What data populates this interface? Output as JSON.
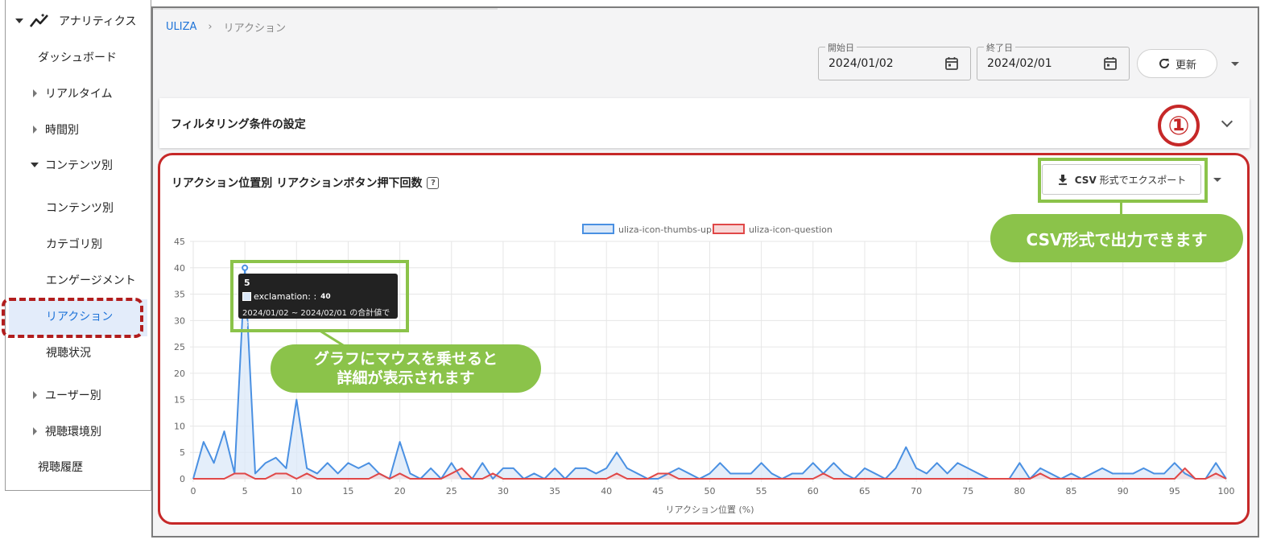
{
  "sidebar": {
    "analytics_label": "アナリティクス",
    "items": [
      {
        "label": "ダッシュボード"
      },
      {
        "label": "リアルタイム"
      },
      {
        "label": "時間別"
      },
      {
        "label": "コンテンツ別"
      },
      {
        "label": "コンテンツ別"
      },
      {
        "label": "カテゴリ別"
      },
      {
        "label": "エンゲージメント"
      },
      {
        "label": "リアクション"
      },
      {
        "label": "視聴状況"
      },
      {
        "label": "ユーザー別"
      },
      {
        "label": "視聴環境別"
      },
      {
        "label": "視聴履歴"
      }
    ]
  },
  "breadcrumb": {
    "root": "ULIZA",
    "sep": "›",
    "current": "リアクション"
  },
  "toolbar": {
    "start_legend": "開始日",
    "start_value": "2024/01/02",
    "end_legend": "終了日",
    "end_value": "2024/02/01",
    "refresh_label": "更新"
  },
  "filter": {
    "title": "フィルタリング条件の設定"
  },
  "annotations": {
    "circle_number": "①",
    "csv_callout": "CSV形式で出力できます",
    "hover_callout_line1": "グラフにマウスを乗せると",
    "hover_callout_line2": "詳細が表示されます"
  },
  "chart_panel": {
    "title": "リアクション位置別 リアクションボタン押下回数",
    "help": "?",
    "csv_button_bold": "CSV",
    "csv_button_rest": "形式でエクスポート"
  },
  "tooltip": {
    "title": "5",
    "series_label": "exclamation: :",
    "series_value": "40",
    "note": "2024/01/02 ~ 2024/02/01 の合計値です"
  },
  "colors": {
    "blue": "#4a90e2",
    "blue_fill": "#dbe8f8",
    "red": "#e04848",
    "red_fill": "#f8d7d7",
    "green": "#8bc34a",
    "dark_red": "#c62828",
    "accent": "#1e73d8"
  },
  "chart_data": {
    "type": "line",
    "xlabel": "リアクション位置 (%)",
    "ylabel": "",
    "xlim": [
      0,
      100
    ],
    "ylim": [
      0,
      45
    ],
    "xticks": [
      0,
      5,
      10,
      15,
      20,
      25,
      30,
      35,
      40,
      45,
      50,
      55,
      60,
      65,
      70,
      75,
      80,
      85,
      90,
      95,
      100
    ],
    "yticks": [
      0,
      5,
      10,
      15,
      20,
      25,
      30,
      35,
      40,
      45
    ],
    "legend_position": "top-center",
    "grid": true,
    "series": [
      {
        "name": "uliza-icon-thumbs-up",
        "color": "#4a90e2",
        "fill": "#dbe8f8",
        "x": [
          0,
          1,
          2,
          3,
          4,
          5,
          6,
          7,
          8,
          9,
          10,
          11,
          12,
          13,
          14,
          15,
          16,
          17,
          18,
          19,
          20,
          21,
          22,
          23,
          24,
          25,
          26,
          27,
          28,
          29,
          30,
          31,
          32,
          33,
          34,
          35,
          36,
          37,
          38,
          39,
          40,
          41,
          42,
          43,
          44,
          45,
          46,
          47,
          48,
          49,
          50,
          51,
          52,
          53,
          54,
          55,
          56,
          57,
          58,
          59,
          60,
          61,
          62,
          63,
          64,
          65,
          66,
          67,
          68,
          69,
          70,
          71,
          72,
          73,
          74,
          75,
          76,
          77,
          78,
          79,
          80,
          81,
          82,
          83,
          84,
          85,
          86,
          87,
          88,
          89,
          90,
          91,
          92,
          93,
          94,
          95,
          96,
          97,
          98,
          99,
          100
        ],
        "y": [
          0,
          7,
          3,
          9,
          1,
          40,
          1,
          3,
          4,
          2,
          15,
          2,
          1,
          3,
          1,
          3,
          2,
          3,
          1,
          0,
          7,
          1,
          0,
          2,
          0,
          3,
          0,
          0,
          3,
          0,
          2,
          2,
          0,
          1,
          0,
          2,
          0,
          2,
          2,
          1,
          2,
          5,
          2,
          1,
          0,
          0,
          1,
          2,
          1,
          0,
          1,
          3,
          1,
          1,
          1,
          3,
          1,
          0,
          1,
          1,
          3,
          1,
          3,
          1,
          0,
          2,
          1,
          0,
          2,
          6,
          2,
          1,
          3,
          1,
          3,
          2,
          1,
          0,
          0,
          0,
          3,
          0,
          2,
          1,
          0,
          1,
          0,
          1,
          2,
          1,
          1,
          1,
          2,
          1,
          1,
          3,
          1,
          0,
          0,
          3,
          0
        ]
      },
      {
        "name": "uliza-icon-question",
        "color": "#e04848",
        "fill": "#f8d7d7",
        "x": [
          0,
          1,
          2,
          3,
          4,
          5,
          6,
          7,
          8,
          9,
          10,
          11,
          12,
          13,
          14,
          15,
          16,
          17,
          18,
          19,
          20,
          21,
          22,
          23,
          24,
          25,
          26,
          27,
          28,
          29,
          30,
          31,
          32,
          33,
          34,
          35,
          36,
          37,
          38,
          39,
          40,
          41,
          42,
          43,
          44,
          45,
          46,
          47,
          48,
          49,
          50,
          51,
          52,
          53,
          54,
          55,
          56,
          57,
          58,
          59,
          60,
          61,
          62,
          63,
          64,
          65,
          66,
          67,
          68,
          69,
          70,
          71,
          72,
          73,
          74,
          75,
          76,
          77,
          78,
          79,
          80,
          81,
          82,
          83,
          84,
          85,
          86,
          87,
          88,
          89,
          90,
          91,
          92,
          93,
          94,
          95,
          96,
          97,
          98,
          99,
          100
        ],
        "y": [
          0,
          0,
          0,
          0,
          1,
          1,
          0,
          0,
          1,
          1,
          0,
          1,
          0,
          0,
          0,
          0,
          0,
          0,
          1,
          0,
          1,
          0,
          0,
          0,
          0,
          1,
          2,
          0,
          0,
          1,
          0,
          0,
          0,
          0,
          0,
          0,
          0,
          0,
          0,
          0,
          0,
          1,
          0,
          0,
          0,
          1,
          1,
          0,
          0,
          0,
          0,
          0,
          0,
          0,
          0,
          0,
          0,
          0,
          0,
          0,
          0,
          1,
          0,
          0,
          0,
          0,
          0,
          0,
          0,
          0,
          0,
          0,
          0,
          0,
          0,
          0,
          0,
          0,
          0,
          0,
          0,
          0,
          1,
          0,
          0,
          0,
          0,
          0,
          0,
          0,
          0,
          0,
          0,
          0,
          0,
          0,
          2,
          0,
          0,
          1,
          0
        ]
      }
    ]
  }
}
